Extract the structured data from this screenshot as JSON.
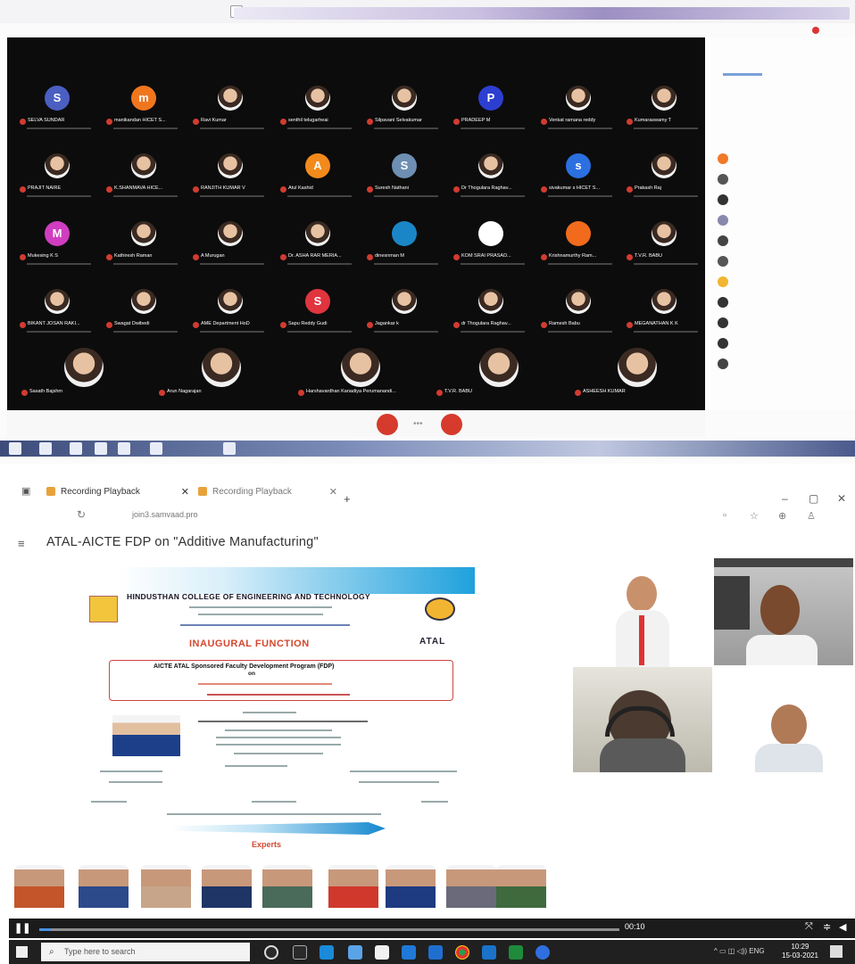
{
  "meeting": {
    "participants": [
      {
        "name": "SELVA SUNDAR",
        "initial": "S",
        "color": "#4a5fc1"
      },
      {
        "name": "manikandan HICET S...",
        "initial": "m",
        "color": "#f0761e"
      },
      {
        "name": "Ravi Kumar",
        "initial": "",
        "color": ""
      },
      {
        "name": "senthil telugarheai",
        "initial": "",
        "color": ""
      },
      {
        "name": "Silpavani Selvakumar",
        "initial": "",
        "color": ""
      },
      {
        "name": "PRADEEP M",
        "initial": "P",
        "color": "#2d3fd0"
      },
      {
        "name": "Venkat ramana reddy",
        "initial": "",
        "color": ""
      },
      {
        "name": "Kumaraswamy T",
        "initial": "",
        "color": ""
      },
      {
        "name": "PRAJIT NAIRE",
        "initial": "",
        "color": ""
      },
      {
        "name": "K.SHANMAVA HICE...",
        "initial": "",
        "color": ""
      },
      {
        "name": "RANJITH KUMAR V",
        "initial": "",
        "color": ""
      },
      {
        "name": "Atul Kashid",
        "initial": "A",
        "color": "#f28a1c"
      },
      {
        "name": "Suresh Nathani",
        "initial": "S",
        "color": "#6e8fb3"
      },
      {
        "name": "Dr Thogulara Raghav...",
        "initial": "",
        "color": ""
      },
      {
        "name": "sivakumar s HICET S...",
        "initial": "s",
        "color": "#2b6fe0"
      },
      {
        "name": "Prakash Raj",
        "initial": "",
        "color": ""
      },
      {
        "name": "Mukesing K S",
        "initial": "M",
        "color": "#d03dc0"
      },
      {
        "name": "Kathiresh Raman",
        "initial": "",
        "color": ""
      },
      {
        "name": "A Murugan",
        "initial": "",
        "color": ""
      },
      {
        "name": "Dr. ASHA RAR MERIA...",
        "initial": "",
        "color": ""
      },
      {
        "name": "dinesnman M",
        "initial": "",
        "color": "#1a86c7"
      },
      {
        "name": "KOM SRAI PRASAD...",
        "initial": "",
        "color": "#ffffff"
      },
      {
        "name": "Krishnamurthy Ram...",
        "initial": "",
        "color": "#f26a1c"
      },
      {
        "name": "T.V.R. BABU",
        "initial": "",
        "color": ""
      },
      {
        "name": "BIKANT JOSAN RAKI...",
        "initial": "",
        "color": ""
      },
      {
        "name": "Swagat Dwibedi",
        "initial": "",
        "color": ""
      },
      {
        "name": "AME Department HoD",
        "initial": "",
        "color": ""
      },
      {
        "name": "Sapu Reddy Gudi",
        "initial": "S",
        "color": "#e0343e"
      },
      {
        "name": "Jagankar k",
        "initial": "",
        "color": ""
      },
      {
        "name": "dr Thogulara Raghav...",
        "initial": "",
        "color": ""
      },
      {
        "name": "Ramesh Babu",
        "initial": "",
        "color": ""
      },
      {
        "name": "MEGANATHAN K K",
        "initial": "",
        "color": ""
      }
    ],
    "featured": [
      {
        "name": "Sasath Bajshm"
      },
      {
        "name": "Arun Nagarajan"
      },
      {
        "name": "Harshavardhan Kanadiya Perumanandi..."
      },
      {
        "name": "T.V.R. BABU"
      },
      {
        "name": "ASHEESH KUMAR"
      }
    ]
  },
  "browser": {
    "tabs": [
      {
        "label": "Recording Playback"
      },
      {
        "label": "Recording Playback"
      }
    ],
    "new_tab": "+",
    "window_controls": [
      "–",
      "▢",
      "✕"
    ],
    "url": "join3.samvaad.pro",
    "reload": "↻"
  },
  "page": {
    "menu_icon": "≡",
    "title": "ATAL-AICTE FDP on \"Additive Manufacturing\""
  },
  "slide": {
    "college": "HINDUSTHAN COLLEGE OF ENGINEERING AND TECHNOLOGY",
    "heading": "INAUGURAL FUNCTION",
    "atal": "ATAL",
    "program": "AICTE ATAL Sponsored Faculty Development Program (FDP)",
    "on": "on",
    "experts": "Experts"
  },
  "player": {
    "time": "00:10",
    "progress": 0.02
  },
  "taskbar": {
    "search_placeholder": "Type here to search",
    "lang": "ENG",
    "time": "10:29",
    "date": "15-03-2021"
  },
  "colors": {
    "end_call": "#d63a2c",
    "tile_bg": "#0c0c0c",
    "accent": "#1fa1dc"
  }
}
